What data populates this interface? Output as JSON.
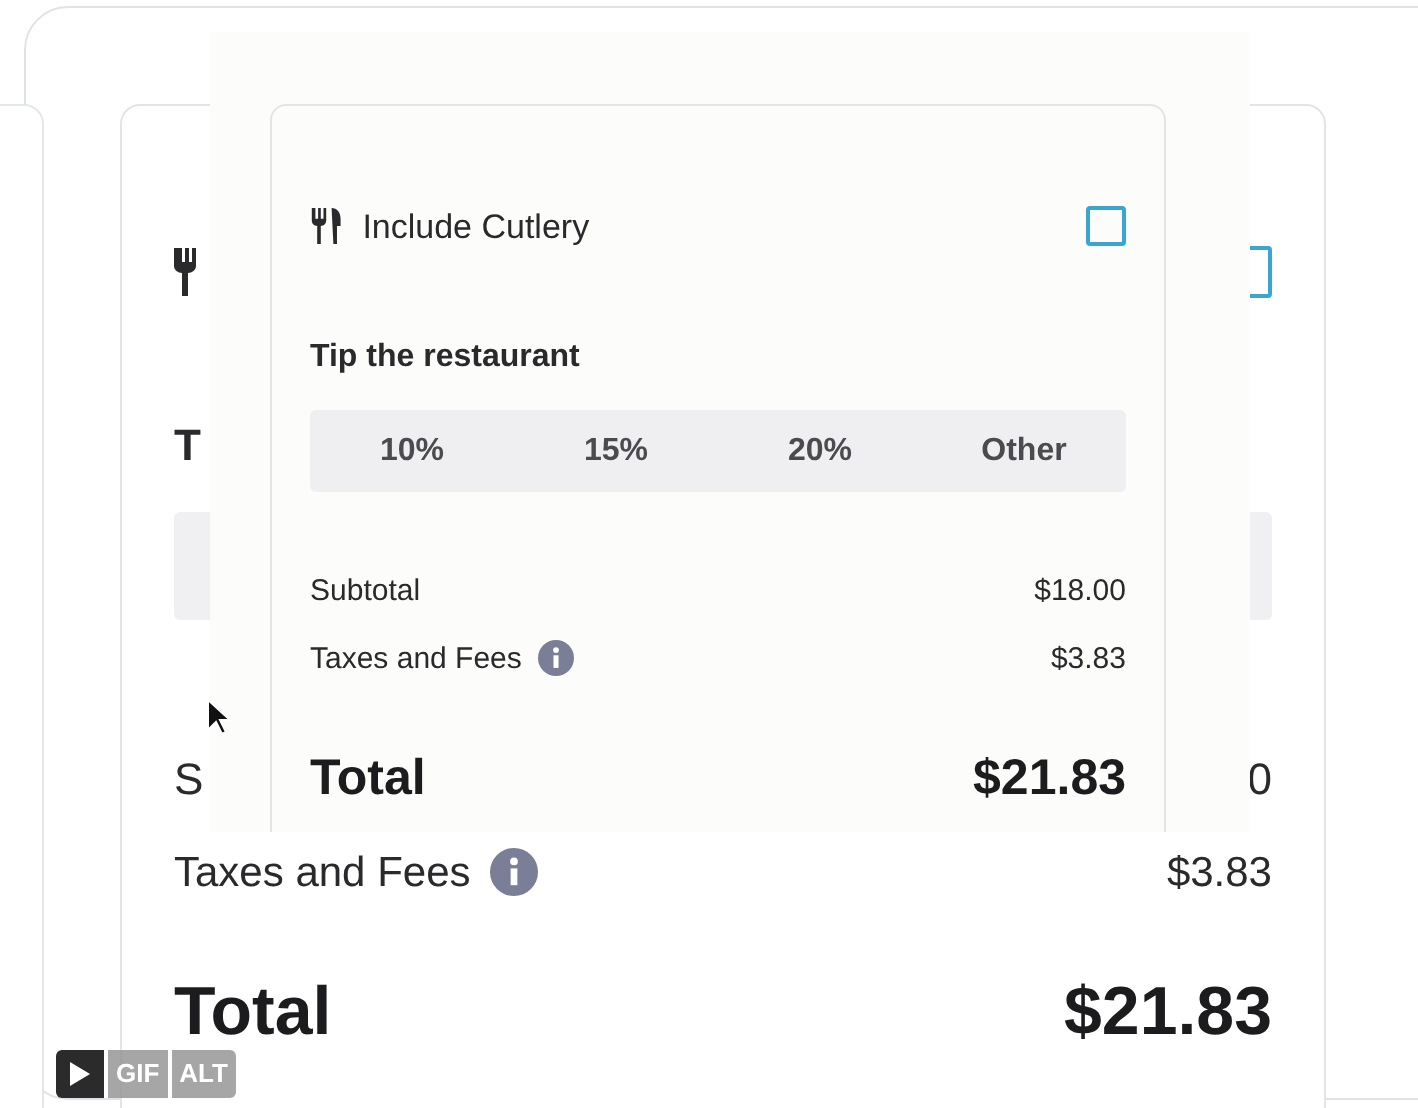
{
  "back_card": {
    "cutlery_checked": false,
    "tip_title": "T",
    "subtotal_label": "S",
    "subtotal_value": "0",
    "taxes_label": "Taxes and Fees",
    "taxes_value": "$3.83",
    "total_label": "Total",
    "total_value": "$21.83"
  },
  "front_card": {
    "cutlery": {
      "label": "Include Cutlery",
      "checked": false
    },
    "tip_title": "Tip the restaurant",
    "tip_options": [
      {
        "label": "10%",
        "selected": false
      },
      {
        "label": "15%",
        "selected": false
      },
      {
        "label": "20%",
        "selected": false
      },
      {
        "label": "Other",
        "selected": false
      }
    ],
    "subtotal": {
      "label": "Subtotal",
      "value": "$18.00"
    },
    "taxes": {
      "label": "Taxes and Fees",
      "value": "$3.83"
    },
    "total": {
      "label": "Total",
      "value": "$21.83"
    }
  },
  "gif_overlay": {
    "badges": [
      "GIF",
      "ALT"
    ]
  }
}
